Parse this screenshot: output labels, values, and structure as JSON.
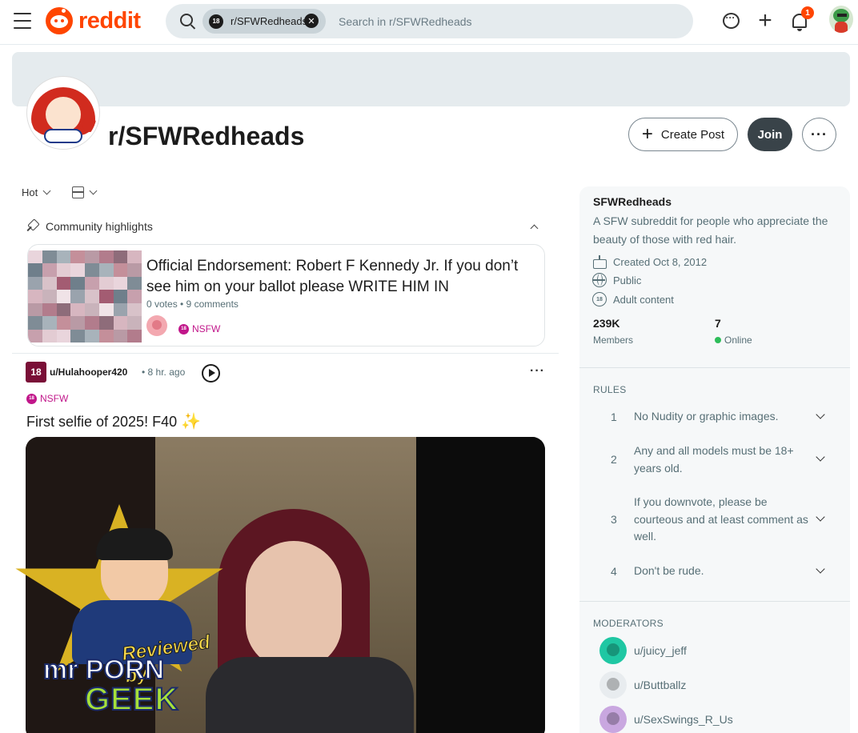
{
  "header": {
    "logo_text": "reddit",
    "search": {
      "chip_avatar": "18",
      "chip_label": "r/SFWRedheads",
      "placeholder": "Search in r/SFWRedheads"
    },
    "notifications_count": "1",
    "icons": [
      "menu-icon",
      "chat-icon",
      "plus-icon",
      "bell-icon"
    ]
  },
  "subreddit": {
    "name": "r/SFWRedheads",
    "create_post_label": "Create Post",
    "join_label": "Join",
    "more_label": "···"
  },
  "feed": {
    "sort_label": "Hot",
    "highlights_label": "Community highlights",
    "highlight_card": {
      "title": "Official Endorsement: Robert F Kennedy Jr. If you don’t see him on your ballot please WRITE HIM IN",
      "meta": "0 votes • 9 comments",
      "nsfw_badge": "18",
      "nsfw_label": "NSFW"
    },
    "post": {
      "avatar_label": "18",
      "author": "u/Hulahooper420",
      "time": "• 8 hr. ago",
      "more": "···",
      "nsfw_badge": "18",
      "nsfw_label": "NSFW",
      "title": "First selfie of 2025! F40",
      "title_emoji": "✨"
    }
  },
  "watermark": {
    "reviewed_by": "Reviewed by",
    "brand_line1": "mr PORN",
    "brand_line2": "GEEK"
  },
  "sidebar": {
    "name": "SFWRedheads",
    "description": "A SFW subreddit for people who appreciate the beauty of those with red hair.",
    "created": "Created Oct 8, 2012",
    "visibility": "Public",
    "adult": "Adult content",
    "adult_badge": "18",
    "members_value": "239K",
    "members_label": "Members",
    "online_value": "7",
    "online_label": "Online",
    "rules_heading": "RULES",
    "rules": [
      {
        "num": "1",
        "text": "No Nudity or graphic images."
      },
      {
        "num": "2",
        "text": "Any and all models must be 18+ years old."
      },
      {
        "num": "3",
        "text": "If you downvote, please be courteous and at least comment as well."
      },
      {
        "num": "4",
        "text": "Don't be rude."
      }
    ],
    "moderators_heading": "MODERATORS",
    "moderators": [
      {
        "name": "u/juicy_jeff",
        "color": "#1fc7a3"
      },
      {
        "name": "u/Buttballz",
        "color": "#e8ecef"
      },
      {
        "name": "u/SexSwings_R_Us",
        "color": "#c9a7e0"
      }
    ]
  },
  "colors": {
    "accent": "#ff4500",
    "nsfw": "#c1168a",
    "join_bg": "#394349",
    "online": "#2ebd5a"
  }
}
